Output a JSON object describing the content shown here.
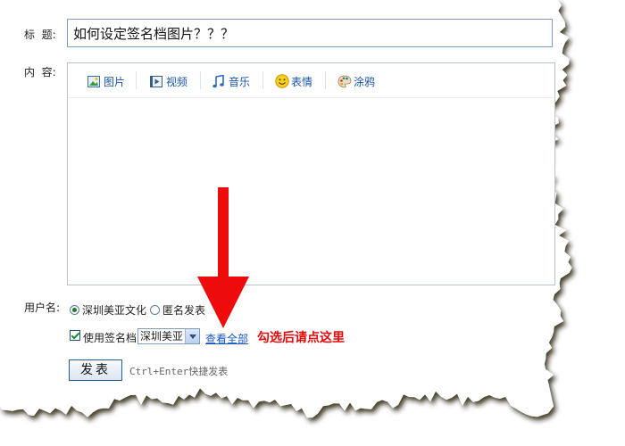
{
  "form": {
    "title_label": "标  题:",
    "title_value": "如何设定签名档图片？？？",
    "content_label": "内  容:",
    "username_label": "用户名:"
  },
  "toolbar": {
    "items": [
      {
        "label": "图片",
        "icon": "image-icon"
      },
      {
        "label": "视频",
        "icon": "video-icon"
      },
      {
        "label": "音乐",
        "icon": "music-icon"
      },
      {
        "label": "表情",
        "icon": "smiley-icon"
      },
      {
        "label": "涂鸦",
        "icon": "palette-icon"
      }
    ]
  },
  "identity": {
    "options": [
      "深圳美亚文化",
      "匿名发表"
    ],
    "selected": "深圳美亚文化"
  },
  "signature": {
    "checkbox_label": "使用签名档",
    "checked": true,
    "select_value": "深圳美亚",
    "view_all_link": "查看全部"
  },
  "annotation": {
    "note": "勾选后请点这里",
    "color": "#e30a0a"
  },
  "actions": {
    "submit_label": "发表",
    "shortcut_hint": "Ctrl+Enter快捷发表"
  }
}
